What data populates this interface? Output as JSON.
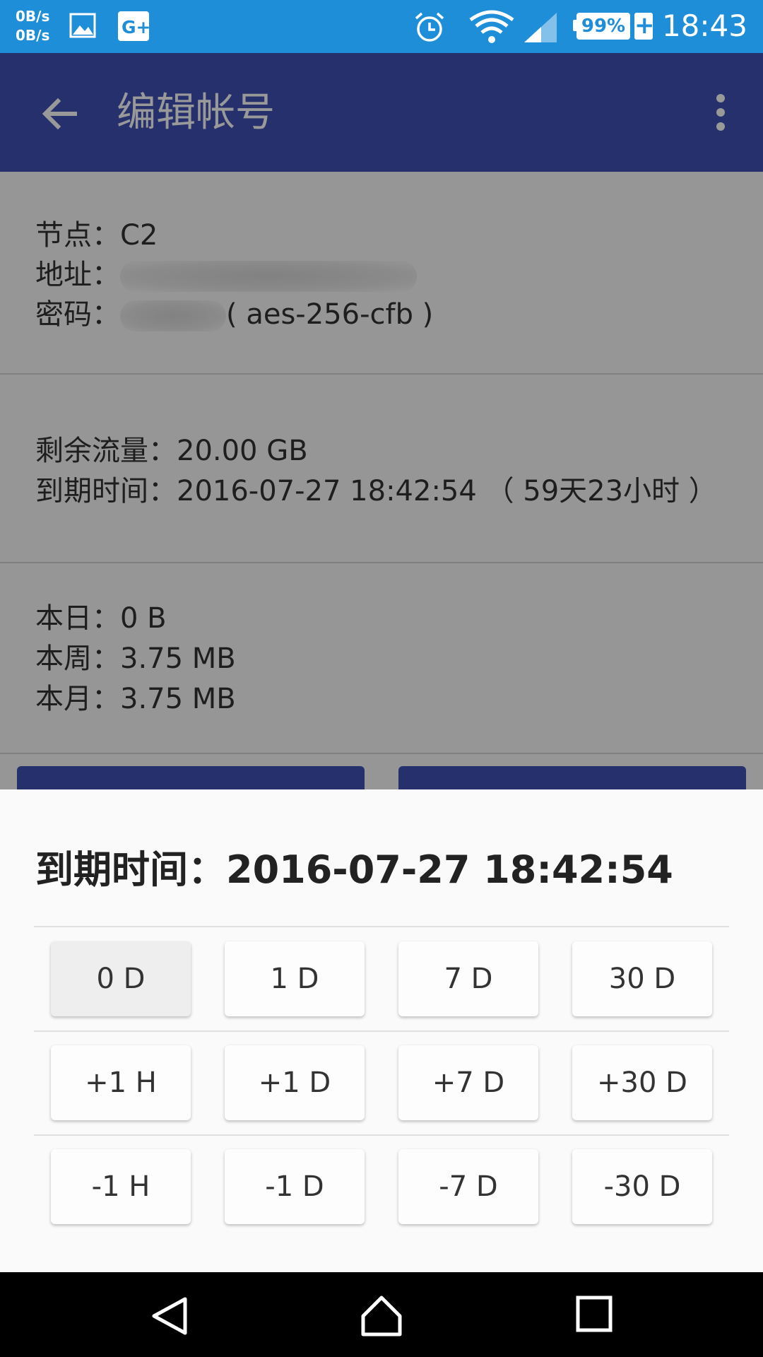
{
  "status_bar": {
    "net_speed_up": "0B/s",
    "net_speed_down": "0B/s",
    "battery": "99%",
    "time": "18:43",
    "icons": [
      "image-icon",
      "google-plus-icon",
      "alarm-icon",
      "wifi-icon",
      "signal-icon",
      "battery-icon"
    ]
  },
  "app_bar": {
    "title": "编辑帐号"
  },
  "node_card": {
    "node": "节点：C2",
    "address_label": "地址：",
    "password_label": "密码：",
    "cipher": "( aes-256-cfb )"
  },
  "traffic_card": {
    "remaining": "剩余流量：20.00 GB",
    "expiry": "到期时间：2016-07-27 18:42:54 （ 59天23小时 ）"
  },
  "usage_card": {
    "today": "本日：0 B",
    "week": "本周：3.75 MB",
    "month": "本月：3.75 MB"
  },
  "sheet": {
    "title": "到期时间：2016-07-27 18:42:54",
    "rows": [
      [
        "0 D",
        "1 D",
        "7 D",
        "30 D"
      ],
      [
        "+1 H",
        "+1 D",
        "+7 D",
        "+30 D"
      ],
      [
        "-1 H",
        "-1 D",
        "-7 D",
        "-30 D"
      ]
    ]
  },
  "colors": {
    "status_bar": "#1f8ed9",
    "primary": "#3f51b5",
    "sheet_background": "#fafafa"
  }
}
